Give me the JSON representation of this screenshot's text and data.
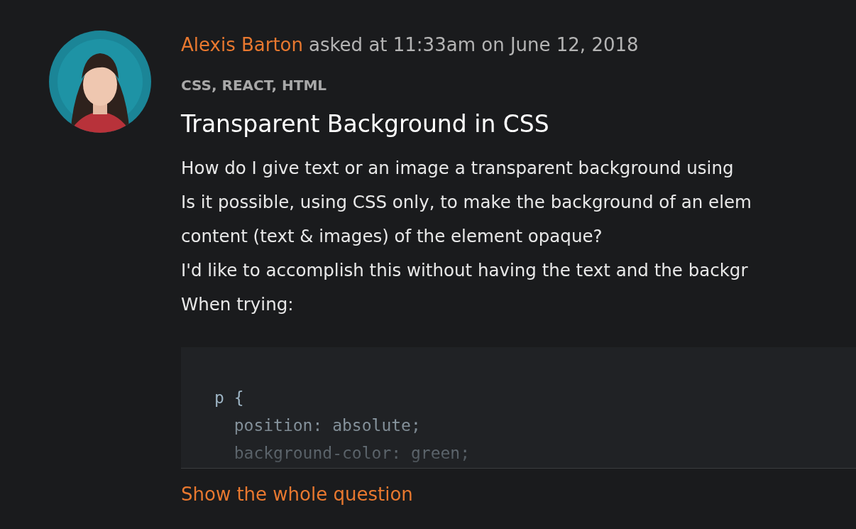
{
  "question": {
    "author": "Alexis Barton",
    "asked": "asked at 11:33am on June 12, 2018",
    "tags": "CSS, REACT, HTML",
    "title": "Transparent Background in CSS",
    "body": [
      "How do I give text or an image a transparent background using",
      "Is it possible, using CSS only, to make the background of an elem",
      "content (text & images) of the element opaque?",
      "I'd like to accomplish this without having the text and the backgr",
      "When trying:"
    ],
    "code": [
      "p {",
      "  position: absolute;",
      "  background-color: green;"
    ],
    "more_link": "Show the whole question"
  }
}
